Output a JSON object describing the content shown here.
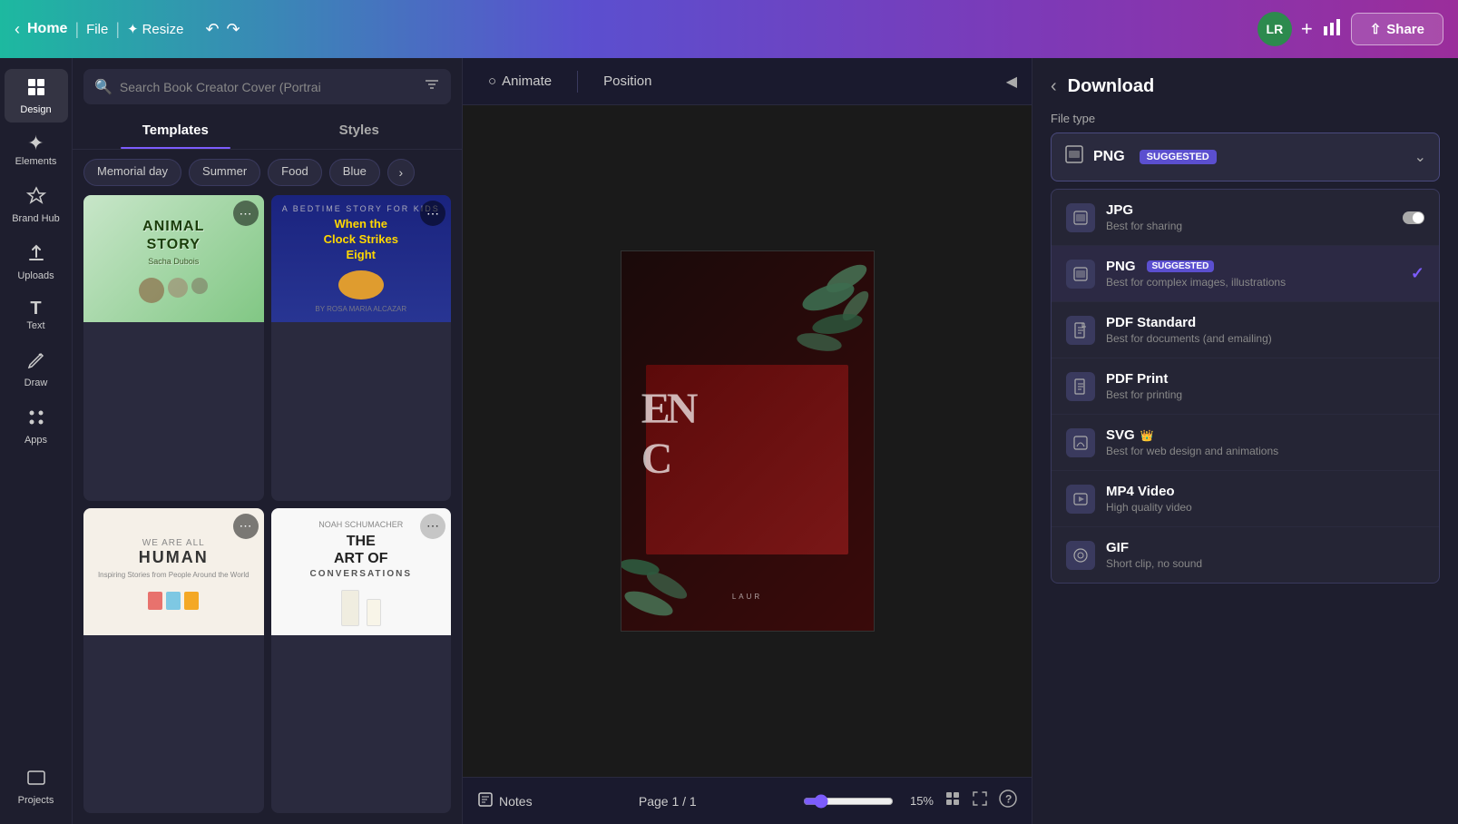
{
  "topbar": {
    "home_label": "Home",
    "file_label": "File",
    "resize_label": "Resize",
    "share_label": "Share",
    "avatar_initials": "LR"
  },
  "search": {
    "placeholder": "Search Book Creator Cover (Portrai"
  },
  "tabs": {
    "templates_label": "Templates",
    "styles_label": "Styles"
  },
  "filter_chips": [
    "Memorial day",
    "Summer",
    "Food",
    "Blue"
  ],
  "sidebar": {
    "items": [
      {
        "id": "design",
        "icon": "⊞",
        "label": "Design"
      },
      {
        "id": "elements",
        "icon": "✦",
        "label": "Elements"
      },
      {
        "id": "brand-hub",
        "icon": "⬡",
        "label": "Brand Hub"
      },
      {
        "id": "uploads",
        "icon": "↑",
        "label": "Uploads"
      },
      {
        "id": "text",
        "icon": "T",
        "label": "Text"
      },
      {
        "id": "draw",
        "icon": "✏",
        "label": "Draw"
      },
      {
        "id": "apps",
        "icon": "⋯",
        "label": "Apps"
      },
      {
        "id": "projects",
        "icon": "◻",
        "label": "Projects"
      }
    ]
  },
  "templates": [
    {
      "id": "animal-story",
      "title": "ANIMAL STORY",
      "subtitle": "Sacha Dubois",
      "type": "animal"
    },
    {
      "id": "clock-strikes",
      "title": "When the Clock Strikes Eight",
      "subtitle": "A BEDTIME STORY FOR KIDS",
      "type": "bedtime"
    },
    {
      "id": "we-are-human",
      "title": "WE ARE ALL HUMAN",
      "subtitle": "Inspiring Stories from People Around the World",
      "type": "human"
    },
    {
      "id": "art-conversations",
      "title": "THE ART OF CONVERSATIONS",
      "subtitle": "Noah Schumacher",
      "type": "art"
    }
  ],
  "canvas": {
    "animate_label": "Animate",
    "position_label": "Position",
    "notes_label": "Notes",
    "page_info": "Page 1 / 1",
    "zoom_value": "15%",
    "zoom_percent": 15
  },
  "download_panel": {
    "title": "Download",
    "filetype_label": "File type",
    "selected_format": "PNG",
    "suggested_text": "SUGGESTED",
    "formats": [
      {
        "id": "jpg",
        "name": "JPG",
        "desc": "Best for sharing",
        "icon": "🖼",
        "has_toggle": true
      },
      {
        "id": "png",
        "name": "PNG",
        "desc": "Best for complex images, illustrations",
        "icon": "🖼",
        "suggested": true,
        "selected": true
      },
      {
        "id": "pdf-standard",
        "name": "PDF Standard",
        "desc": "Best for documents (and emailing)",
        "icon": "📄"
      },
      {
        "id": "pdf-print",
        "name": "PDF Print",
        "desc": "Best for printing",
        "icon": "📄"
      },
      {
        "id": "svg",
        "name": "SVG",
        "desc": "Best for web design and animations",
        "icon": "🖼",
        "crown": true
      },
      {
        "id": "mp4",
        "name": "MP4 Video",
        "desc": "High quality video",
        "icon": "▶"
      },
      {
        "id": "gif",
        "name": "GIF",
        "desc": "Short clip, no sound",
        "icon": "◎"
      }
    ]
  }
}
